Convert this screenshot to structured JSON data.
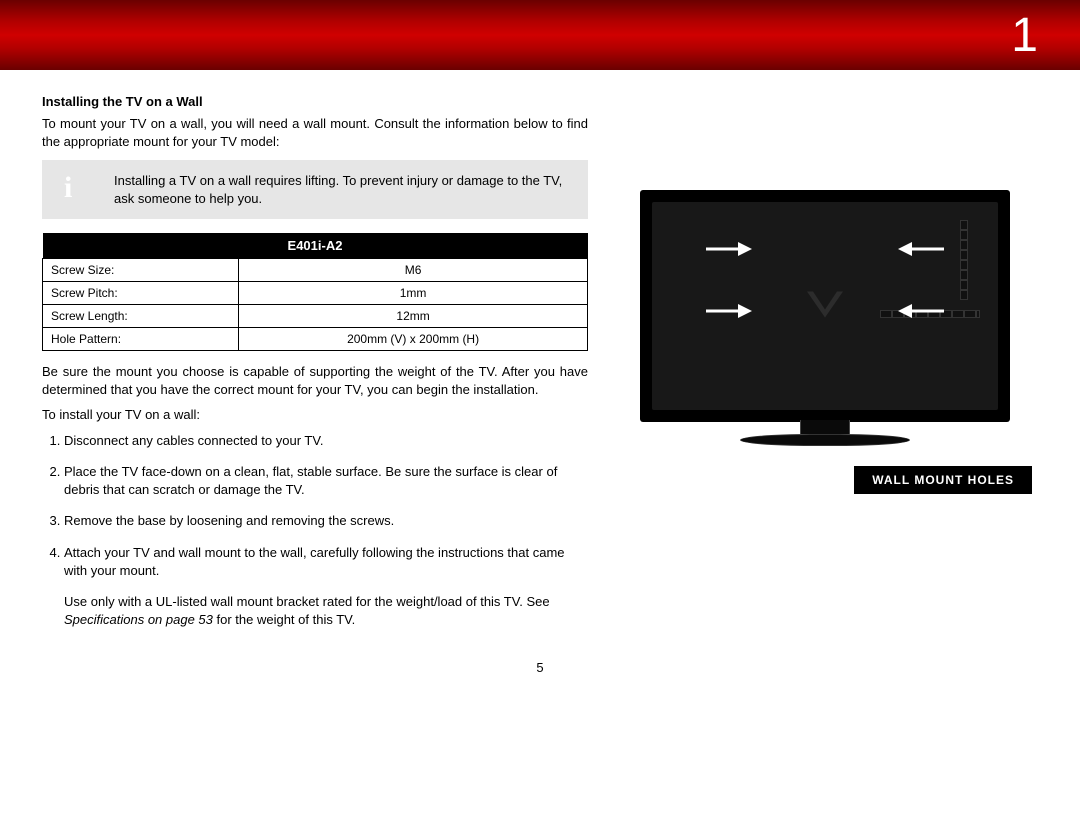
{
  "header": {
    "page_section": "1"
  },
  "doc": {
    "h2": "Installing the TV on a Wall",
    "intro": "To mount your TV on a wall, you will need a wall mount. Consult the information below to find the appropriate mount for your TV model:",
    "callout": "Installing a TV on a wall requires lifting. To prevent injury or damage to the TV, ask someone to help you.",
    "table": {
      "title": "E401i-A2",
      "rows": [
        {
          "k": "Screw Size:",
          "v": "M6"
        },
        {
          "k": "Screw Pitch:",
          "v": "1mm"
        },
        {
          "k": "Screw Length:",
          "v": "12mm"
        },
        {
          "k": "Hole Pattern:",
          "v": "200mm (V) x 200mm (H)"
        }
      ]
    },
    "para2": "Be sure the mount you choose is capable of supporting the weight of the TV. After you have determined that you have the correct mount for your TV, you can begin the installation.",
    "listIntro": "To install your TV on a wall:",
    "steps": [
      "Disconnect any cables connected to your TV.",
      "Place the TV face-down on a clean, flat, stable surface. Be sure the surface is clear of debris that can scratch or damage the TV.",
      "Remove the base by loosening and removing the screws.",
      "Attach your TV and wall mount to the wall, carefully following the instructions that came with your mount."
    ],
    "note_pre": "Use only with a UL-listed wall mount bracket rated for the weight/load of this TV. See ",
    "note_em": "Specifications on page 53",
    "note_post": " for the weight of this TV.",
    "diagram_label": "WALL MOUNT HOLES",
    "footer_page": "5"
  }
}
